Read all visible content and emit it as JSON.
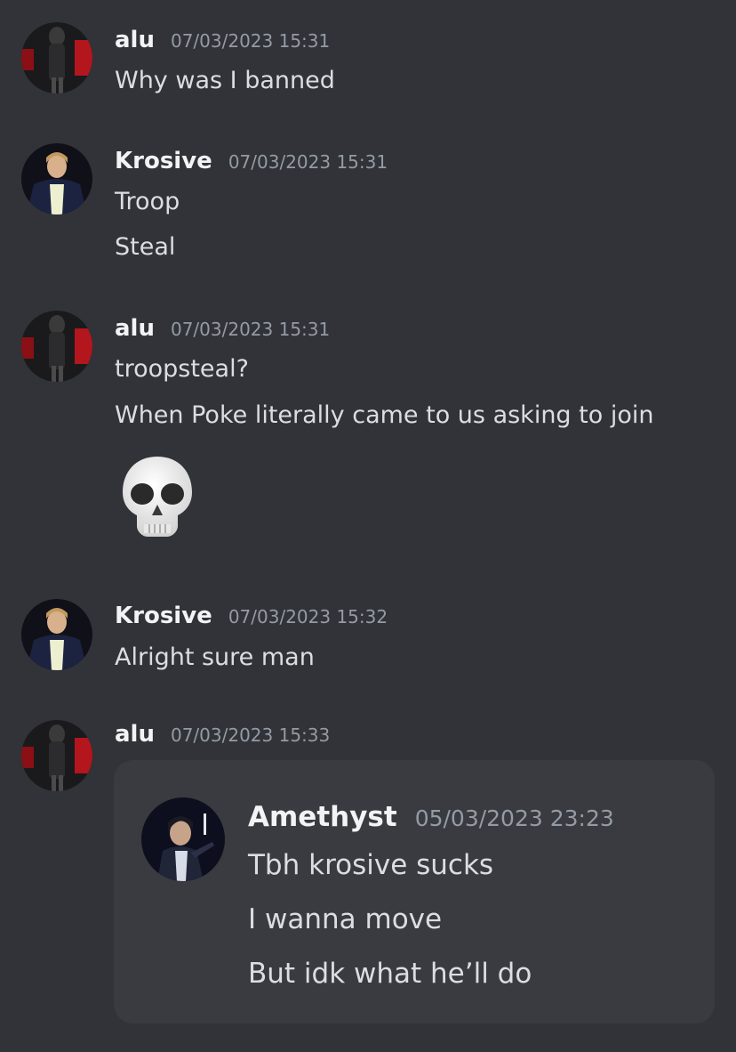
{
  "messages": [
    {
      "author": "alu",
      "avatar_icon": "alu-avatar",
      "timestamp": "07/03/2023 15:31",
      "lines": [
        "Why was I banned"
      ]
    },
    {
      "author": "Krosive",
      "avatar_icon": "krosive-avatar",
      "timestamp": "07/03/2023 15:31",
      "lines": [
        "Troop",
        "Steal"
      ]
    },
    {
      "author": "alu",
      "avatar_icon": "alu-avatar",
      "timestamp": "07/03/2023 15:31",
      "lines": [
        "troopsteal?",
        "When Poke literally came to us asking to join"
      ],
      "emoji": "skull-emoji"
    },
    {
      "author": "Krosive",
      "avatar_icon": "krosive-avatar",
      "timestamp": "07/03/2023 15:32",
      "lines": [
        "Alright sure man"
      ]
    },
    {
      "author": "alu",
      "avatar_icon": "alu-avatar",
      "timestamp": "07/03/2023 15:33",
      "lines": [],
      "embed": {
        "author": "Amethyst",
        "avatar_icon": "amethyst-avatar",
        "timestamp": "05/03/2023 23:23",
        "lines": [
          "Tbh krosive sucks",
          "I wanna move",
          "But idk what he’ll do"
        ]
      }
    }
  ],
  "colors": {
    "background": "#313338",
    "embed_background": "#393b41",
    "username": "#f2f3f5",
    "timestamp": "#949ba4",
    "message_text": "#dbdee1"
  }
}
